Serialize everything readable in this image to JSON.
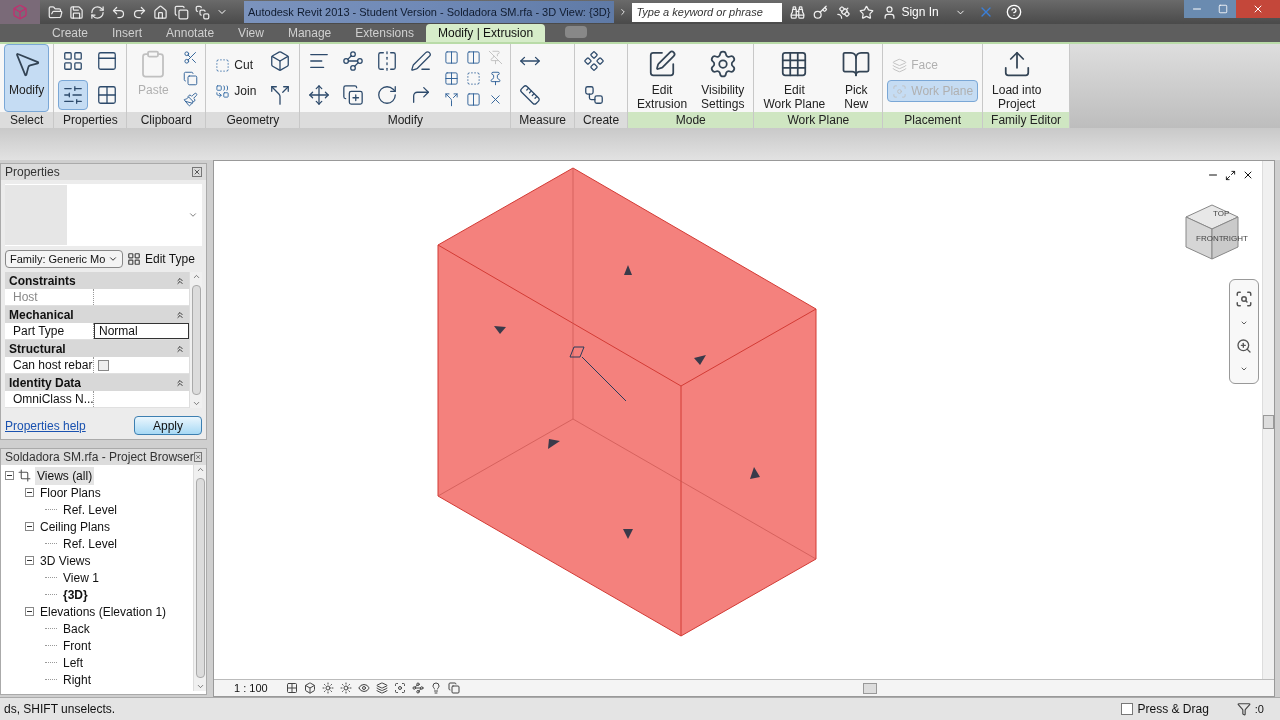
{
  "title_bar": {
    "title": "Autodesk Revit 2013 - Student Version - Soldadora SM.rfa - 3D View: {3D}",
    "search": {
      "placeholder": "Type a keyword or phrase"
    },
    "sign_in": "Sign In"
  },
  "tabs": [
    {
      "label": "Create",
      "selected": false
    },
    {
      "label": "Insert",
      "selected": false
    },
    {
      "label": "Annotate",
      "selected": false
    },
    {
      "label": "View",
      "selected": false
    },
    {
      "label": "Manage",
      "selected": false
    },
    {
      "label": "Extensions",
      "selected": false
    },
    {
      "label": "Modify | Extrusion",
      "selected": true
    }
  ],
  "ribbon": [
    {
      "label": "Select",
      "contextual": false,
      "tools": [
        {
          "kind": "large",
          "label": "Modify",
          "selected": true,
          "disabled": false
        }
      ]
    },
    {
      "label": "Properties",
      "contextual": false,
      "tools": [
        {
          "kind": "icon",
          "selected": false,
          "disabled": false
        },
        {
          "kind": "icon",
          "selected": true,
          "disabled": false
        },
        {
          "kind": "icon",
          "selected": false,
          "disabled": false
        },
        {
          "kind": "icon",
          "selected": false,
          "disabled": false
        }
      ]
    },
    {
      "label": "Clipboard",
      "contextual": false,
      "tools": [
        {
          "kind": "large",
          "label": "Paste",
          "selected": false,
          "disabled": true
        },
        {
          "kind": "mini",
          "selected": false,
          "disabled": false
        },
        {
          "kind": "mini",
          "selected": false,
          "disabled": false
        },
        {
          "kind": "mini",
          "selected": false,
          "disabled": false
        }
      ]
    },
    {
      "label": "Geometry",
      "contextual": false,
      "tools": [
        {
          "kind": "small",
          "label": "Cut",
          "selected": false,
          "disabled": false
        },
        {
          "kind": "small",
          "label": "Join",
          "selected": false,
          "disabled": false
        },
        {
          "kind": "icon",
          "selected": false,
          "disabled": false
        },
        {
          "kind": "icon",
          "selected": false,
          "disabled": false
        }
      ]
    },
    {
      "label": "Modify",
      "contextual": false,
      "tools": [
        {
          "kind": "icon",
          "selected": false,
          "disabled": false
        },
        {
          "kind": "icon",
          "selected": false,
          "disabled": false
        },
        {
          "kind": "icon",
          "selected": false,
          "disabled": false
        },
        {
          "kind": "icon",
          "selected": false,
          "disabled": false
        },
        {
          "kind": "icon",
          "selected": false,
          "disabled": false
        },
        {
          "kind": "icon",
          "selected": false,
          "disabled": false
        },
        {
          "kind": "icon",
          "selected": false,
          "disabled": false
        },
        {
          "kind": "icon",
          "selected": false,
          "disabled": false
        },
        {
          "kind": "mini",
          "selected": false,
          "disabled": false
        },
        {
          "kind": "mini",
          "selected": false,
          "disabled": false
        },
        {
          "kind": "mini",
          "selected": false,
          "disabled": false
        },
        {
          "kind": "mini",
          "selected": false,
          "disabled": false
        },
        {
          "kind": "mini",
          "selected": false,
          "disabled": false
        },
        {
          "kind": "mini",
          "selected": false,
          "disabled": false
        },
        {
          "kind": "mini",
          "selected": false,
          "disabled": true
        },
        {
          "kind": "mini",
          "selected": false,
          "disabled": false
        },
        {
          "kind": "mini",
          "selected": false,
          "disabled": false
        }
      ]
    },
    {
      "label": "Measure",
      "contextual": false,
      "tools": [
        {
          "kind": "icon",
          "selected": false,
          "disabled": false
        },
        {
          "kind": "icon",
          "selected": false,
          "disabled": false
        }
      ]
    },
    {
      "label": "Create",
      "contextual": false,
      "tools": [
        {
          "kind": "icon",
          "selected": false,
          "disabled": false
        },
        {
          "kind": "icon",
          "selected": false,
          "disabled": false
        }
      ]
    },
    {
      "label": "Mode",
      "contextual": true,
      "tools": [
        {
          "kind": "large",
          "label": "Edit\nExtrusion",
          "selected": false,
          "disabled": false
        },
        {
          "kind": "large",
          "label": "Visibility\nSettings",
          "selected": false,
          "disabled": false
        }
      ]
    },
    {
      "label": "Work Plane",
      "contextual": true,
      "tools": [
        {
          "kind": "large",
          "label": "Edit\nWork Plane",
          "selected": false,
          "disabled": false
        },
        {
          "kind": "large",
          "label": "Pick\nNew",
          "selected": false,
          "disabled": false
        }
      ]
    },
    {
      "label": "Placement",
      "contextual": true,
      "tools": [
        {
          "kind": "small",
          "label": "Face",
          "selected": false,
          "disabled": true
        },
        {
          "kind": "small",
          "label": "Work Plane",
          "selected": true,
          "disabled": true
        }
      ]
    },
    {
      "label": "Family Editor",
      "contextual": true,
      "tools": [
        {
          "kind": "large",
          "label": "Load into\nProject",
          "selected": false,
          "disabled": false
        }
      ]
    }
  ],
  "properties": {
    "title": "Properties",
    "type_selector": "Family: Generic Mo",
    "edit_type": "Edit Type",
    "rows": [
      {
        "kind": "group",
        "label": "Constraints",
        "expanded": true
      },
      {
        "kind": "text",
        "label": "Host",
        "disabled": true,
        "selected": false
      },
      {
        "kind": "group",
        "label": "Mechanical",
        "expanded": true
      },
      {
        "kind": "text",
        "label": "Part Type",
        "value": "Normal",
        "disabled": false,
        "selected": true
      },
      {
        "kind": "group",
        "label": "Structural",
        "expanded": true
      },
      {
        "kind": "checkbox",
        "label": "Can host rebar",
        "checked": false,
        "disabled": false,
        "selected": false
      },
      {
        "kind": "group",
        "label": "Identity Data",
        "expanded": true
      },
      {
        "kind": "text",
        "label": "OmniClass N...",
        "disabled": false,
        "selected": false
      }
    ],
    "help": "Properties help",
    "apply": "Apply"
  },
  "project_browser": {
    "title": "Soldadora SM.rfa - Project Browser",
    "tree": [
      {
        "label": "Views (all)",
        "expanded": true,
        "current": false,
        "children": [
          {
            "label": "Floor Plans",
            "expanded": true,
            "current": false,
            "children": [
              {
                "label": "Ref. Level",
                "current": false
              }
            ]
          },
          {
            "label": "Ceiling Plans",
            "expanded": true,
            "current": false,
            "children": [
              {
                "label": "Ref. Level",
                "current": false
              }
            ]
          },
          {
            "label": "3D Views",
            "expanded": true,
            "current": false,
            "children": [
              {
                "label": "View 1",
                "current": false
              },
              {
                "label": "{3D}",
                "current": true
              }
            ]
          },
          {
            "label": "Elevations (Elevation 1)",
            "expanded": true,
            "current": false,
            "children": [
              {
                "label": "Back",
                "current": false
              },
              {
                "label": "Front",
                "current": false
              },
              {
                "label": "Left",
                "current": false
              },
              {
                "label": "Right",
                "current": false
              }
            ]
          }
        ]
      }
    ]
  },
  "view": {
    "viewcube": {
      "top": "TOP",
      "front": "FRONT",
      "right": "RIGHT"
    },
    "scale": "1 : 100"
  },
  "status_bar": {
    "message": "ds, SHIFT unselects.",
    "press_drag": {
      "label": "Press & Drag",
      "checked": false
    },
    "filter_count": ":0"
  }
}
